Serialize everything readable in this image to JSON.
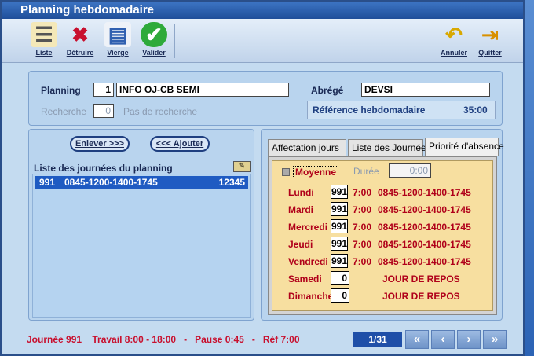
{
  "title": "Planning hebdomadaire",
  "toolbar": {
    "liste": "Liste",
    "detruire": "Détruire",
    "vierge": "Vierge",
    "valider": "Valider",
    "annuler": "Annuler",
    "quitter": "Quitter"
  },
  "form": {
    "planning_label": "Planning",
    "planning_num": "1",
    "planning_name": "INFO OJ-CB SEMI",
    "abrege_label": "Abrégé",
    "abrege_value": "DEVSI",
    "recherche_label": "Recherche",
    "recherche_value": "0",
    "recherche_text": "Pas de recherche",
    "ref_label": "Référence hebdomadaire",
    "ref_value": "35:00"
  },
  "buttons": {
    "enlever": "Enlever >>>",
    "ajouter": "<<< Ajouter"
  },
  "list": {
    "header": "Liste des journées du planning",
    "items": [
      {
        "code": "991",
        "hours": "0845-1200-1400-1745",
        "days": "12345"
      }
    ]
  },
  "tabs": [
    "Affectation jours",
    "Liste des Journées",
    "Priorité d'absence"
  ],
  "affect": {
    "moyenne": "Moyenne",
    "duree_label": "Durée",
    "duree_value": "0:00",
    "days": [
      {
        "name": "Lundi",
        "num": "991",
        "time": "7:00",
        "hours": "0845-1200-1400-1745"
      },
      {
        "name": "Mardi",
        "num": "991",
        "time": "7:00",
        "hours": "0845-1200-1400-1745"
      },
      {
        "name": "Mercredi",
        "num": "991",
        "time": "7:00",
        "hours": "0845-1200-1400-1745"
      },
      {
        "name": "Jeudi",
        "num": "991",
        "time": "7:00",
        "hours": "0845-1200-1400-1745"
      },
      {
        "name": "Vendredi",
        "num": "991",
        "time": "7:00",
        "hours": "0845-1200-1400-1745"
      },
      {
        "name": "Samedi",
        "num": "0",
        "time": "",
        "hours": "JOUR DE REPOS"
      },
      {
        "name": "Dimanche",
        "num": "0",
        "time": "",
        "hours": "JOUR DE REPOS"
      }
    ]
  },
  "status": {
    "text": "Journée 991    Travail 8:00 - 18:00   -   Pause 0:45   -   Réf 7:00",
    "page": "1/31"
  },
  "colors": {
    "accent": "#1f5bc2",
    "status_text": "#c8102e",
    "day_text": "#b0001a"
  }
}
